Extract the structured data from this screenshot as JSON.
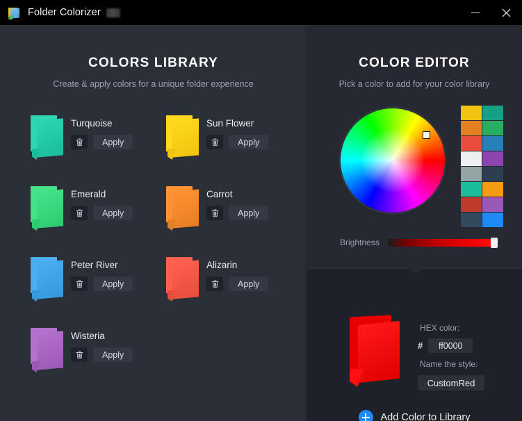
{
  "window": {
    "title": "Folder Colorizer",
    "redacted_badge": "",
    "minimize_label": "Minimize",
    "close_label": "Close",
    "app_icon": "folder-colorizer-icon"
  },
  "library": {
    "title": "COLORS LIBRARY",
    "subtitle": "Create & apply colors for a unique folder experience",
    "delete_icon": "trash-icon",
    "apply_label": "Apply",
    "items": [
      {
        "name": "Turquoise",
        "color": "#1abc9c",
        "dark": "#15a085",
        "light": "#2fd6b4"
      },
      {
        "name": "Sun Flower",
        "color": "#f1c40f",
        "dark": "#d4ab06",
        "light": "#ffd91f"
      },
      {
        "name": "Emerald",
        "color": "#2ecc71",
        "dark": "#27ae60",
        "light": "#44e389"
      },
      {
        "name": "Carrot",
        "color": "#e67e22",
        "dark": "#cf6d15",
        "light": "#ff9334"
      },
      {
        "name": "Peter River",
        "color": "#3498db",
        "dark": "#2a80bd",
        "light": "#4aaef0"
      },
      {
        "name": "Alizarin",
        "color": "#e74c3c",
        "dark": "#cf3d2e",
        "light": "#ff6151"
      },
      {
        "name": "Wisteria",
        "color": "#9b59b6",
        "dark": "#8647a1",
        "light": "#b471cd"
      }
    ]
  },
  "editor": {
    "title": "COLOR EDITOR",
    "subtitle": "Pick a color to add for your color library",
    "wheel_name": "hue-color-wheel",
    "cursor_name": "wheel-selector",
    "swatches": [
      "#f1c40f",
      "#16a085",
      "#e67e22",
      "#27ae60",
      "#e74c3c",
      "#2980b9",
      "#ecf0f1",
      "#8e44ad",
      "#95a5a6",
      "#2c3e50",
      "#1abc9c",
      "#f39c12",
      "#c0392b",
      "#9b59b6",
      "#34495e",
      "#1f8af5"
    ],
    "brightness_label": "Brightness",
    "brightness_value": "100",
    "preview_color": "#ff0000",
    "hex_label": "HEX color:",
    "hex_prefix": "#",
    "hex_value": "ff0000",
    "name_label": "Name the style:",
    "name_value": "CustomRed",
    "add_button_label": "Add Color to Library",
    "add_button_icon": "plus-circle-icon",
    "accent_color": "#1f8af5"
  }
}
